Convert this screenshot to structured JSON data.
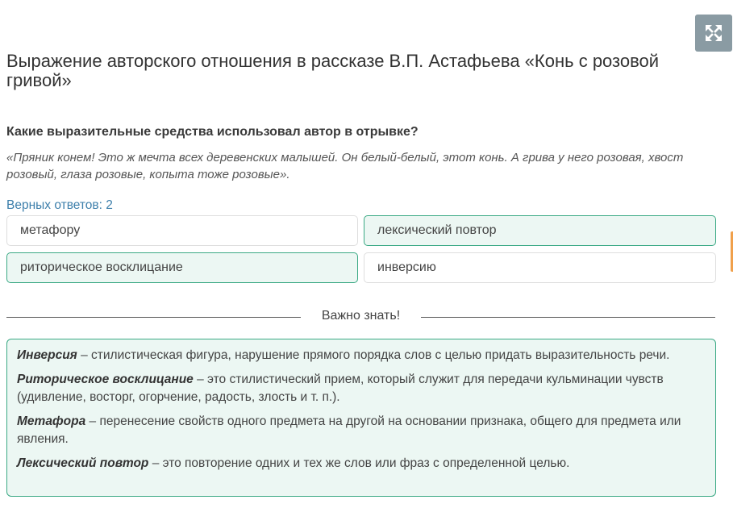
{
  "header": {
    "title": "Выражение авторского отношения в рассказе В.П. Астафьева «Конь с розовой гривой»"
  },
  "question": {
    "text": "Какие выразительные средства использовал автор в отрывке?",
    "quote": "«Пряник конем! Это ж мечта всех деревенских малышей. Он белый-белый, этот конь. А грива у него розовая, хвост розовый, глаза розовые, копыта тоже розовые».",
    "correct_answers": "Верных ответов: 2"
  },
  "options": [
    {
      "label": "метафору",
      "selected": false
    },
    {
      "label": "лексический повтор",
      "selected": true
    },
    {
      "label": "риторическое восклицание",
      "selected": true
    },
    {
      "label": "инверсию",
      "selected": false
    }
  ],
  "important": {
    "heading": "Важно знать!",
    "items": [
      {
        "term": "Инверсия",
        "definition": " – стилистическая фигура, нарушение прямого порядка слов с целью придать выразительность речи."
      },
      {
        "term": "Риторическое восклицание",
        "definition": " – это стилистический прием, который служит для передачи кульминации чувств (удивление, восторг, огорчение, радость, злость и т. п.)."
      },
      {
        "term": "Метафора",
        "definition": " – перенесение свойств одного предмета на другой на основании признака, общего для предмета или явления."
      },
      {
        "term": "Лексический повтор",
        "definition": " – это повторение одних и тех же слов или фраз с определенной целью."
      }
    ]
  },
  "colors": {
    "accent": "#3aa984",
    "selected_bg": "#ecf7f3",
    "link_blue": "#3d7fab",
    "expand_bg": "#8a9ba3"
  },
  "icons": {
    "expand": "expand-arrows-icon"
  }
}
